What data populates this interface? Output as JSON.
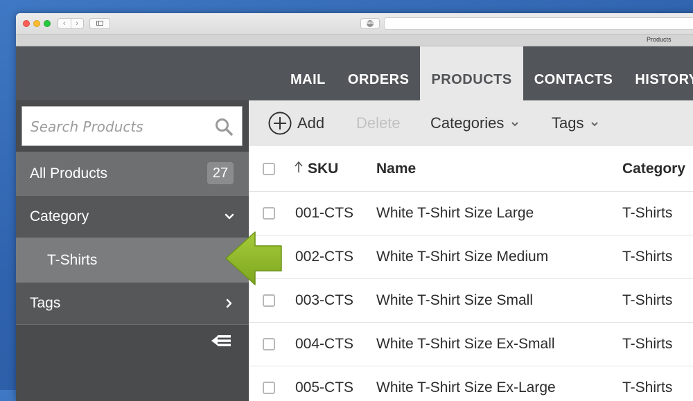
{
  "browser": {
    "tab_title": "Products",
    "back_glyph": "‹",
    "forward_glyph": "›",
    "abp_label": "ABP"
  },
  "nav": {
    "tabs": [
      {
        "label": "MAIL",
        "active": false
      },
      {
        "label": "ORDERS",
        "active": false
      },
      {
        "label": "PRODUCTS",
        "active": true
      },
      {
        "label": "CONTACTS",
        "active": false
      },
      {
        "label": "HISTORY",
        "active": false
      }
    ]
  },
  "sidebar": {
    "search_placeholder": "Search Products",
    "all_products": {
      "label": "All Products",
      "count": "27"
    },
    "category": {
      "label": "Category",
      "expanded": true
    },
    "category_items": [
      {
        "label": "T-Shirts",
        "selected": true
      }
    ],
    "tags": {
      "label": "Tags",
      "expanded": false
    }
  },
  "toolbar": {
    "add_label": "Add",
    "delete_label": "Delete",
    "categories_label": "Categories",
    "tags_label": "Tags"
  },
  "table": {
    "columns": [
      "SKU",
      "Name",
      "Category"
    ],
    "sort": {
      "column": "SKU",
      "direction": "ascending"
    },
    "rows": [
      {
        "sku": "001-CTS",
        "name": "White T-Shirt Size Large",
        "category": "T-Shirts"
      },
      {
        "sku": "002-CTS",
        "name": "White T-Shirt Size Medium",
        "category": "T-Shirts"
      },
      {
        "sku": "003-CTS",
        "name": "White T-Shirt Size Small",
        "category": "T-Shirts"
      },
      {
        "sku": "004-CTS",
        "name": "White T-Shirt Size Ex-Small",
        "category": "T-Shirts"
      },
      {
        "sku": "005-CTS",
        "name": "White T-Shirt Size Ex-Large",
        "category": "T-Shirts"
      }
    ]
  },
  "colors": {
    "nav_bg": "#52565a",
    "sidebar_bg": "#494b4d",
    "highlight_arrow": "#8db82b",
    "active_tab_bg": "#e8e8e8"
  }
}
